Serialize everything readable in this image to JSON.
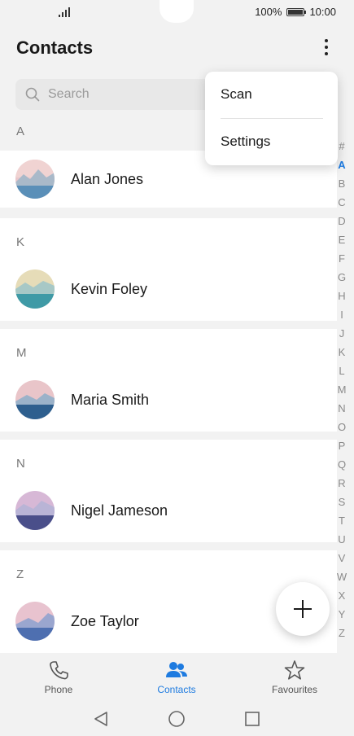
{
  "status_bar": {
    "battery": "100%",
    "time": "10:00"
  },
  "header": {
    "title": "Contacts",
    "more_icon": "more-vertical-icon"
  },
  "search": {
    "placeholder": "Search",
    "icon": "search-icon"
  },
  "menu": {
    "items": [
      "Scan",
      "Settings"
    ]
  },
  "groups": [
    {
      "letter": "A",
      "contacts": [
        {
          "name": "Alan Jones"
        }
      ]
    },
    {
      "letter": "K",
      "contacts": [
        {
          "name": "Kevin Foley"
        }
      ]
    },
    {
      "letter": "M",
      "contacts": [
        {
          "name": "Maria Smith"
        }
      ]
    },
    {
      "letter": "N",
      "contacts": [
        {
          "name": "Nigel Jameson"
        }
      ]
    },
    {
      "letter": "Z",
      "contacts": [
        {
          "name": "Zoe Taylor"
        }
      ]
    }
  ],
  "index": {
    "letters": [
      "#",
      "A",
      "B",
      "C",
      "D",
      "E",
      "F",
      "G",
      "H",
      "I",
      "J",
      "K",
      "L",
      "M",
      "N",
      "O",
      "P",
      "Q",
      "R",
      "S",
      "T",
      "U",
      "V",
      "W",
      "X",
      "Y",
      "Z"
    ],
    "active": "A"
  },
  "fab": {
    "icon": "plus-icon"
  },
  "bottom_nav": {
    "items": [
      {
        "label": "Phone",
        "icon": "phone-icon"
      },
      {
        "label": "Contacts",
        "icon": "contacts-icon"
      },
      {
        "label": "Favourites",
        "icon": "star-icon"
      }
    ],
    "active": "Contacts"
  },
  "system_nav": {
    "icons": [
      "back-icon",
      "home-icon",
      "recents-icon"
    ]
  },
  "colors": {
    "accent": "#1e7be0",
    "background": "#f2f2f2",
    "card": "#ffffff"
  }
}
